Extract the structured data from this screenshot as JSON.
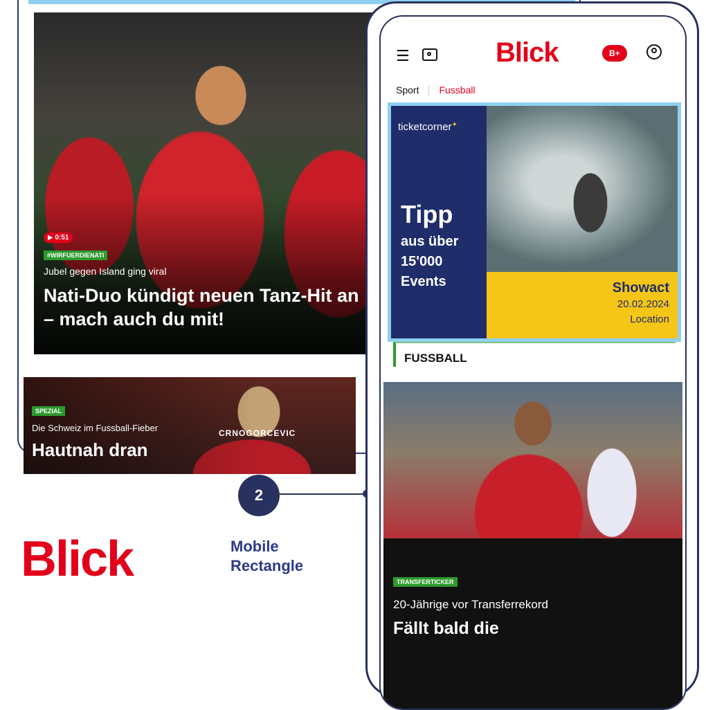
{
  "desktop": {
    "hero": {
      "video_badge": "▶ 0:51",
      "tag": "#WIRFUERDIENATI",
      "kicker": "Jubel gegen Island ging viral",
      "title": "Nati-Duo kündigt neuen Tanz-Hit an – mach auch du mit!"
    },
    "teaser2": {
      "tag": "SPEZIAL",
      "kicker": "Die Schweiz im Fussball-Fieber",
      "title": "Hautnah dran",
      "jersey": "CRNOGORCEVIC"
    }
  },
  "branding": {
    "logo": "Blick",
    "step_number": "2",
    "step_label_line1": "Mobile",
    "step_label_line2": "Rectangle"
  },
  "mobile": {
    "logo": "Blick",
    "bplus": "B+",
    "menu_icon": "hamburger-icon",
    "breadcrumb": {
      "parent": "Sport",
      "current": "Fussball"
    },
    "ad": {
      "brand": "ticketcorner",
      "headline": "Tipp",
      "sub_line1": "aus über",
      "sub_line2": "15'000",
      "sub_line3": "Events",
      "showact": "Showact",
      "date": "20.02.2024",
      "location": "Location"
    },
    "section_title": "FUSSBALL",
    "story": {
      "tag": "TRANSFERTICKER",
      "kicker": "20-Jährige vor Transferrekord",
      "title": "Fällt bald die"
    }
  },
  "colors": {
    "brand_red": "#e2001a",
    "navy": "#28315f",
    "highlight": "#8fd0f0",
    "tag_green": "#2d9a2d",
    "ad_yellow": "#f5c518"
  }
}
